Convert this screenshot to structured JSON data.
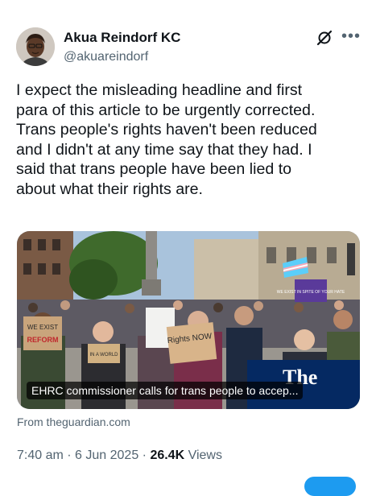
{
  "author": {
    "name": "Akua Reindorf KC",
    "handle": "@akuareindorf"
  },
  "icons": {
    "grok": "grok-icon",
    "more": "more-icon"
  },
  "tweet": {
    "lines": [
      "I expect the misleading headline and first",
      "para of this article to be urgently corrected.",
      "Trans people's rights haven't been reduced",
      "and I didn't at any time say that they had. I",
      "said that trans people have been lied to",
      "about what their rights are."
    ]
  },
  "card": {
    "caption": "EHRC commissioner calls for trans people to accep...",
    "source": "From theguardian.com",
    "signs": {
      "sign1": "WE EXIST",
      "sign2": "REFORM",
      "sign3": "IN A WORLD",
      "sign4": "Rights NOW",
      "sign5": "WE EXIST IN SPITE OF YOUR HATE",
      "logo": "The"
    }
  },
  "meta": {
    "time": "7:40 am",
    "sep1": " · ",
    "date": "6 Jun 2025",
    "sep2": " · ",
    "views_count": "26.4K",
    "views_label": " Views"
  },
  "colors": {
    "text": "#0f1419",
    "secondary": "#536471",
    "accent": "#1d9bf0"
  }
}
